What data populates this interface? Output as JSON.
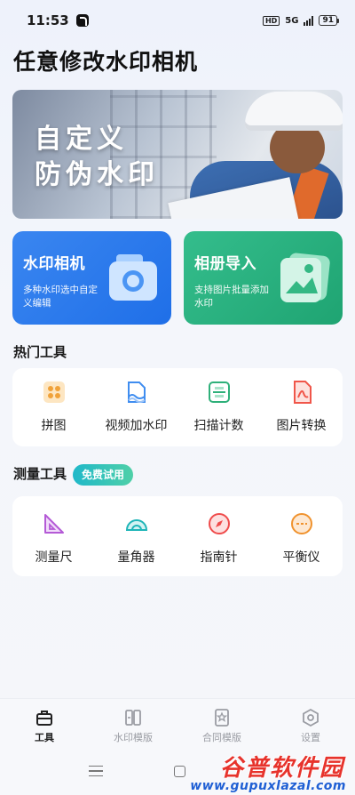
{
  "status_bar": {
    "time": "11:53",
    "hd": "HD",
    "network": "5G",
    "battery": "91"
  },
  "app": {
    "title": "任意修改水印相机"
  },
  "banner": {
    "line1": "自定义",
    "line2": "防伪水印"
  },
  "features": [
    {
      "title": "水印相机",
      "subtitle": "多种水印选中自定义编辑",
      "icon": "camera-icon"
    },
    {
      "title": "相册导入",
      "subtitle": "支持图片批量添加水印",
      "icon": "photo-import-icon"
    }
  ],
  "hot_tools": {
    "title": "热门工具",
    "items": [
      {
        "label": "拼图",
        "icon": "collage-icon",
        "color": "#f0a23a"
      },
      {
        "label": "视频加水印",
        "icon": "video-watermark-icon",
        "color": "#3f8df0"
      },
      {
        "label": "扫描计数",
        "icon": "scan-count-icon",
        "color": "#2fb07a"
      },
      {
        "label": "图片转换",
        "icon": "pdf-convert-icon",
        "color": "#f0564a"
      }
    ]
  },
  "measure_tools": {
    "title": "测量工具",
    "badge": "免费试用",
    "items": [
      {
        "label": "测量尺",
        "icon": "ruler-icon",
        "color": "#b45ad6"
      },
      {
        "label": "量角器",
        "icon": "protractor-icon",
        "color": "#1fb5b8"
      },
      {
        "label": "指南针",
        "icon": "compass-icon",
        "color": "#ef4b4b"
      },
      {
        "label": "平衡仪",
        "icon": "level-icon",
        "color": "#f0922d"
      }
    ]
  },
  "bottom_nav": [
    {
      "label": "工具",
      "icon": "toolbox-icon",
      "active": true
    },
    {
      "label": "水印模版",
      "icon": "watermark-template-icon",
      "active": false
    },
    {
      "label": "合同模版",
      "icon": "contract-template-icon",
      "active": false
    },
    {
      "label": "设置",
      "icon": "settings-icon",
      "active": false
    }
  ],
  "watermark": {
    "brand": "谷普软件园",
    "url": "www.gupuxlazal.com"
  }
}
